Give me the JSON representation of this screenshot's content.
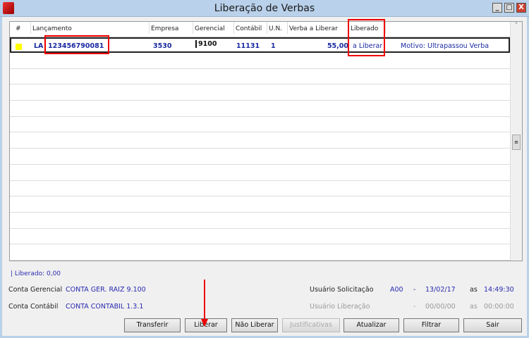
{
  "window": {
    "title": "Liberação de Verbas",
    "minimize": "_",
    "maximize": "□",
    "close": "X"
  },
  "grid": {
    "columns": [
      "#",
      "Lançamento",
      "Empresa",
      "Gerencial",
      "Contábil",
      "U.N.",
      "Verba a Liberar",
      "Liberado"
    ],
    "row": {
      "tipo": "LA",
      "lancamento": "123456790081",
      "empresa": "3530",
      "gerencial": "9100",
      "contabil": "11131",
      "un": "1",
      "verba": "55,00",
      "liberado": "a Liberar",
      "motivo": "Motivo: Ultrapassou Verba"
    }
  },
  "summary": {
    "liberado": "| Liberado: 0,00"
  },
  "info": {
    "conta_gerencial_label": "Conta Gerencial",
    "conta_gerencial": "CONTA GER. RAIZ 9.100",
    "conta_contabil_label": "Conta Contábil",
    "conta_contabil": "CONTA CONTABIL 1.3.1",
    "usuario_solicitacao_label": "Usuário Solicitação",
    "sol_user": "A00",
    "sol_dash": "-",
    "sol_date": "13/02/17",
    "sol_as": "as",
    "sol_time": "14:49:30",
    "usuario_liberacao_label": "Usuário Liberação",
    "lib_dash": "-",
    "lib_date": "00/00/00",
    "lib_as": "as",
    "lib_time": "00:00:00"
  },
  "buttons": {
    "transferir": "Transferir",
    "liberar": "Liberar",
    "nao_liberar": "Não Liberar",
    "justificativas": "Justificativas",
    "atualizar": "Atualizar",
    "filtrar": "Filtrar",
    "sair": "Sair"
  }
}
